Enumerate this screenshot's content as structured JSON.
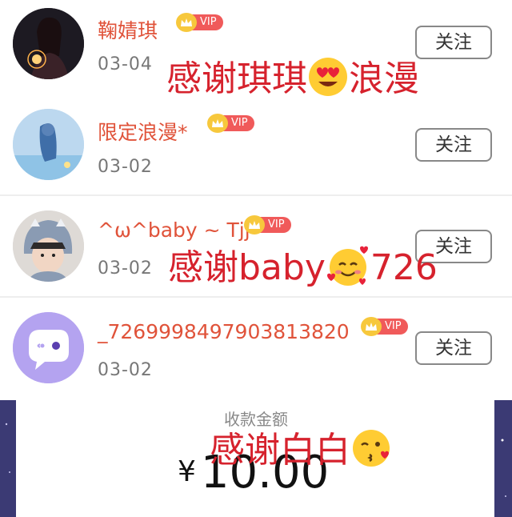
{
  "rows": [
    {
      "name": "鞠婧琪",
      "date": "03-04",
      "follow": "关注",
      "vip": "VIP"
    },
    {
      "name": "限定浪漫*",
      "date": "03-02",
      "follow": "关注",
      "vip": "VIP"
    },
    {
      "name": "^ω^baby ~ Tjj",
      "date": "03-02",
      "follow": "关注",
      "vip": "VIP"
    },
    {
      "name": "_7269998497903813820",
      "date": "03-02",
      "follow": "关注",
      "vip": "VIP"
    }
  ],
  "overlays": {
    "line1_a": "感谢琪琪",
    "line1_b": "浪漫",
    "line2_a": "感谢baby",
    "line2_b": "726",
    "line3_a": "感谢白白"
  },
  "payment": {
    "label": "收款金额",
    "currency": "¥",
    "amount": "10.00"
  },
  "colors": {
    "name": "#e0533a",
    "overlay": "#d6222d",
    "vip": "#f05a5a",
    "bg_purple": "#3b3a74"
  }
}
